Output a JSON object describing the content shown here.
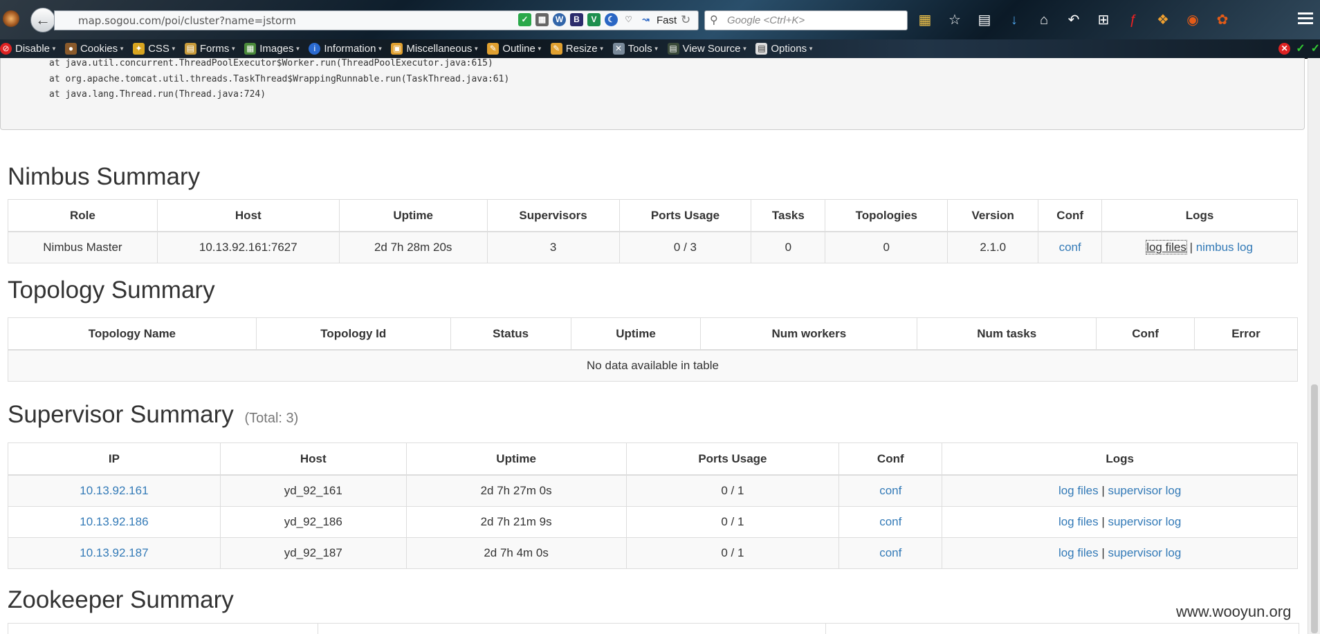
{
  "browser": {
    "url": "map.sogou.com/poi/cluster?name=jstorm",
    "speed_label": "Fast",
    "search_placeholder": "Google <Ctrl+K>",
    "devbar": [
      "Disable",
      "Cookies",
      "CSS",
      "Forms",
      "Images",
      "Information",
      "Miscellaneous",
      "Outline",
      "Resize",
      "Tools",
      "View Source",
      "Options"
    ]
  },
  "trace": {
    "lines": [
      "at java.util.concurrent.ThreadPoolExecutor$Worker.run(ThreadPoolExecutor.java:615)",
      "at org.apache.tomcat.util.threads.TaskThread$WrappingRunnable.run(TaskThread.java:61)",
      "at java.lang.Thread.run(Thread.java:724)"
    ]
  },
  "nimbus": {
    "title": "Nimbus Summary",
    "headers": [
      "Role",
      "Host",
      "Uptime",
      "Supervisors",
      "Ports Usage",
      "Tasks",
      "Topologies",
      "Version",
      "Conf",
      "Logs"
    ],
    "row": {
      "role": "Nimbus Master",
      "host": "10.13.92.161:7627",
      "uptime": "2d 7h 28m 20s",
      "supervisors": "3",
      "ports_usage": "0 / 3",
      "tasks": "0",
      "topologies": "0",
      "version": "2.1.0",
      "conf": "conf",
      "log_files": "log files",
      "sep": "|",
      "nimbus_log": "nimbus log"
    }
  },
  "topology": {
    "title": "Topology Summary",
    "headers": [
      "Topology Name",
      "Topology Id",
      "Status",
      "Uptime",
      "Num workers",
      "Num tasks",
      "Conf",
      "Error"
    ],
    "empty": "No data available in table"
  },
  "supervisor": {
    "title": "Supervisor Summary",
    "total": "(Total: 3)",
    "headers": [
      "IP",
      "Host",
      "Uptime",
      "Ports Usage",
      "Conf",
      "Logs"
    ],
    "rows": [
      {
        "ip": "10.13.92.161",
        "host": "yd_92_161",
        "uptime": "2d 7h 27m 0s",
        "ports": "0 / 1",
        "conf": "conf",
        "log_files": "log files",
        "sep": "|",
        "sup_log": "supervisor log"
      },
      {
        "ip": "10.13.92.186",
        "host": "yd_92_186",
        "uptime": "2d 7h 21m 9s",
        "ports": "0 / 1",
        "conf": "conf",
        "log_files": "log files",
        "sep": "|",
        "sup_log": "supervisor log"
      },
      {
        "ip": "10.13.92.187",
        "host": "yd_92_187",
        "uptime": "2d 7h 4m 0s",
        "ports": "0 / 1",
        "conf": "conf",
        "log_files": "log files",
        "sep": "|",
        "sup_log": "supervisor log"
      }
    ]
  },
  "zookeeper": {
    "title": "Zookeeper Summary"
  },
  "watermark": "www.wooyun.org",
  "colors": {
    "link": "#337ab7",
    "text": "#333333",
    "border": "#dddddd"
  }
}
